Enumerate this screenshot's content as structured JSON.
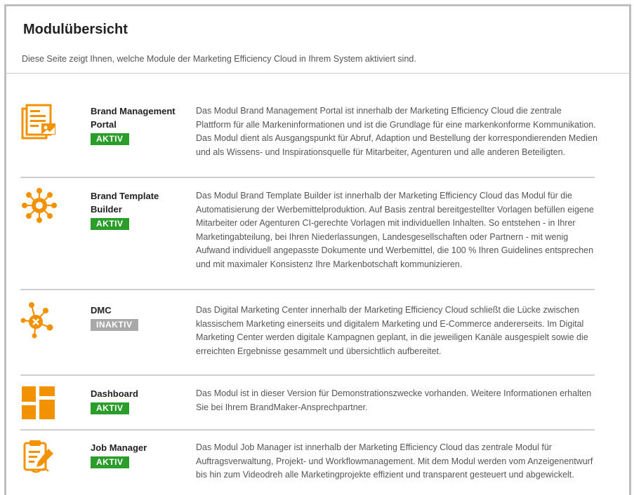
{
  "page": {
    "title": "Modulübersicht",
    "intro": "Diese Seite zeigt Ihnen, welche Module der Marketing Efficiency Cloud in Ihrem System aktiviert sind."
  },
  "colors": {
    "accent": "#f39200",
    "active": "#2a9d2a",
    "inactive": "#a9a9a9"
  },
  "modules": [
    {
      "name": "Brand Management Portal",
      "status": "AKTIV",
      "icon": "document-icon",
      "description": "Das Modul Brand Management Portal ist innerhalb der Marketing Efficiency Cloud die zentrale Plattform für alle Markeninformationen und ist die Grundlage für eine markenkonforme Kommunikation. Das Modul dient als Ausgangspunkt für Abruf, Adaption und Bestellung der korrespondierenden Medien und als Wissens- und Inspirationsquelle für Mitarbeiter, Agenturen und alle anderen Beteiligten."
    },
    {
      "name": "Brand Template Builder",
      "status": "AKTIV",
      "icon": "network-icon",
      "description": "Das Modul Brand Template Builder ist innerhalb der Marketing Efficiency Cloud das Modul für die Automatisierung der Werbemittelproduktion. Auf Basis zentral bereitgestellter Vorlagen befüllen eigene Mitarbeiter oder Agenturen CI-gerechte Vorlagen mit individuellen Inhalten. So entstehen - in Ihrer Marketingabteilung, bei Ihren Niederlassungen, Landesgesellschaften oder Partnern - mit wenig Aufwand individuell angepasste Dokumente und Werbemittel, die 100 % Ihren Guidelines entsprechen und mit maximaler Konsistenz Ihre Markenbotschaft kommunizieren."
    },
    {
      "name": "DMC",
      "status": "INAKTIV",
      "icon": "molecule-icon",
      "description": "Das Digital Marketing Center innerhalb der Marketing Efficiency Cloud schließt die Lücke zwischen klassischem Marketing einerseits und digitalem Marketing und E-Commerce andererseits. Im Digital Marketing Center werden digitale Kampagnen geplant, in die jeweiligen Kanäle ausgespielt sowie die erreichten Ergebnisse gesammelt und übersichtlich aufbereitet."
    },
    {
      "name": "Dashboard",
      "status": "AKTIV",
      "icon": "dashboard-icon",
      "description": "Das Modul ist in dieser Version für Demonstrationszwecke vorhanden. Weitere Informationen erhalten Sie bei Ihrem BrandMaker-Ansprechpartner."
    },
    {
      "name": "Job Manager",
      "status": "AKTIV",
      "icon": "clipboard-icon",
      "description": "Das Modul Job Manager ist innerhalb der Marketing Efficiency Cloud das zentrale Modul für Auftragsverwaltung, Projekt- und Workflowmanagement. Mit dem Modul werden vom Anzeigenentwurf bis hin zum Videodreh alle Marketingprojekte effizient und transparent gesteuert und abgewickelt."
    }
  ]
}
